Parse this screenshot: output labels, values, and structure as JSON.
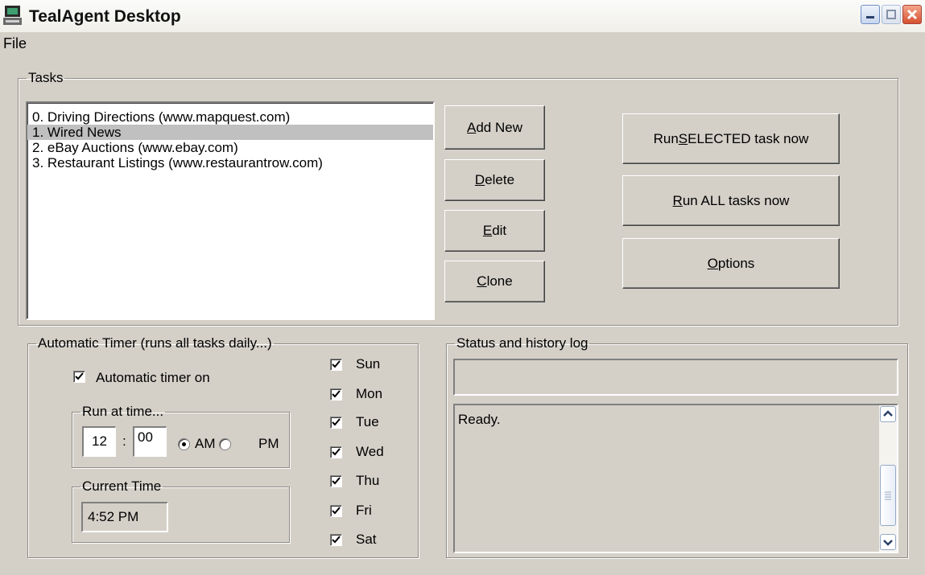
{
  "window": {
    "title": "TealAgent Desktop"
  },
  "menu": {
    "file": "File"
  },
  "tasks": {
    "legend": "Tasks",
    "items": [
      "0.  Driving Directions (www.mapquest.com)",
      "1.  Wired News",
      "2.  eBay Auctions (www.ebay.com)",
      "3.  Restaurant Listings (www.restaurantrow.com)"
    ],
    "selected_index": 1,
    "buttons": {
      "add_new": {
        "mnemonic": "A",
        "rest": "dd New"
      },
      "delete": {
        "mnemonic": "D",
        "rest": "elete"
      },
      "edit": {
        "mnemonic": "E",
        "rest": "dit"
      },
      "clone": {
        "mnemonic": "C",
        "rest": "lone"
      },
      "run_selected": {
        "pre": "Run ",
        "mnemonic": "S",
        "rest": "ELECTED task now"
      },
      "run_all": {
        "pre": "",
        "mnemonic": "R",
        "rest": "un ALL tasks now"
      },
      "options": {
        "pre": "",
        "mnemonic": "O",
        "rest": "ptions"
      }
    }
  },
  "timer": {
    "legend": "Automatic Timer  (runs all tasks daily...)",
    "auto_on_label": "Automatic timer on",
    "auto_on_checked": true,
    "run_at": {
      "legend": "Run at time...",
      "hour": "12",
      "separator": ":",
      "minute": "00",
      "am_label": "AM",
      "pm_label": "PM",
      "selected": "AM"
    },
    "current_time": {
      "legend": "Current Time",
      "value": "4:52 PM"
    },
    "days": [
      {
        "label": "Sun",
        "checked": true
      },
      {
        "label": "Mon",
        "checked": true
      },
      {
        "label": "Tue",
        "checked": true
      },
      {
        "label": "Wed",
        "checked": true
      },
      {
        "label": "Thu",
        "checked": true
      },
      {
        "label": "Fri",
        "checked": true
      },
      {
        "label": "Sat",
        "checked": true
      }
    ]
  },
  "status": {
    "legend": "Status and history log",
    "current": "",
    "log": "Ready."
  },
  "icons": {
    "app": "app-computer-icon",
    "minimize": "minimize-icon",
    "maximize": "maximize-icon",
    "close": "close-icon",
    "scroll_up": "chevron-up-icon",
    "scroll_down": "chevron-down-icon"
  }
}
